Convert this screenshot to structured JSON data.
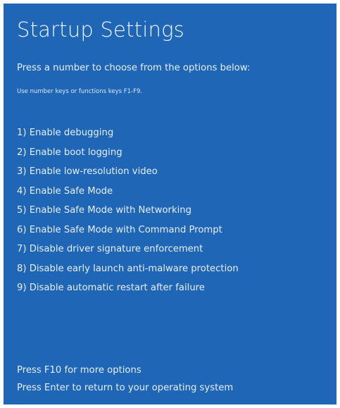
{
  "screen": {
    "title": "Startup Settings",
    "subtitle": "Press a number to choose from the options below:",
    "hint": "Use number keys or functions keys F1-F9.",
    "background_color": "#1f67b6",
    "options": [
      {
        "label": "1) Enable debugging"
      },
      {
        "label": "2) Enable boot logging"
      },
      {
        "label": "3) Enable low-resolution video"
      },
      {
        "label": "4) Enable Safe Mode"
      },
      {
        "label": "5) Enable Safe Mode with Networking"
      },
      {
        "label": "6) Enable Safe Mode with Command Prompt"
      },
      {
        "label": "7) Disable driver signature enforcement"
      },
      {
        "label": "8) Disable early launch anti-malware protection"
      },
      {
        "label": "9) Disable automatic restart after failure"
      }
    ],
    "footer": {
      "more_options": "Press F10 for more options",
      "return": "Press Enter to return to your operating system"
    }
  }
}
